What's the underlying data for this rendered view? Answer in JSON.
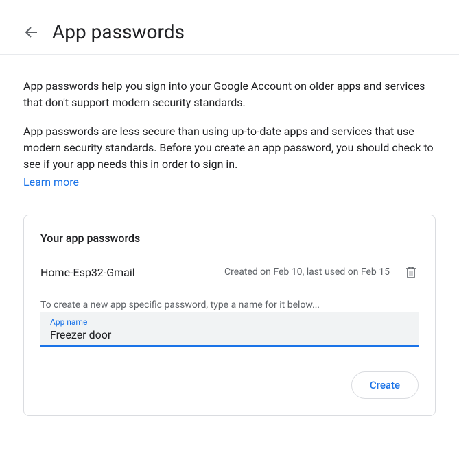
{
  "header": {
    "title": "App passwords"
  },
  "description": {
    "p1": "App passwords help you sign into your Google Account on older apps and services that don't support modern security standards.",
    "p2": "App passwords are less secure than using up-to-date apps and services that use modern security standards. Before you create an app password, you should check to see if your app needs this in order to sign in.",
    "learn_more": "Learn more"
  },
  "card": {
    "title": "Your app passwords",
    "items": [
      {
        "name": "Home-Esp32-Gmail",
        "meta": "Created on Feb 10, last used on Feb 15"
      }
    ],
    "hint": "To create a new app specific password, type a name for it below...",
    "input_label": "App name",
    "input_value": "Freezer door",
    "create_label": "Create"
  }
}
